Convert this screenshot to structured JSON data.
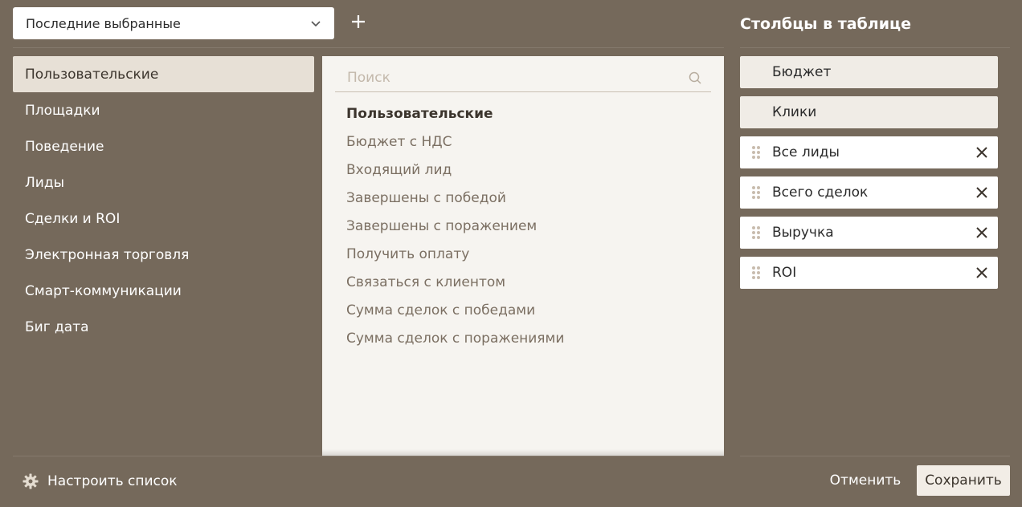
{
  "preset": {
    "value": "Последние выбранные"
  },
  "categories": [
    {
      "label": "Пользовательские",
      "active": true
    },
    {
      "label": "Площадки"
    },
    {
      "label": "Поведение"
    },
    {
      "label": "Лиды"
    },
    {
      "label": "Сделки и ROI"
    },
    {
      "label": "Электронная торговля"
    },
    {
      "label": "Смарт-коммуникации"
    },
    {
      "label": "Биг дата"
    }
  ],
  "search": {
    "placeholder": "Поиск"
  },
  "metrics": {
    "heading": "Пользовательские",
    "items": [
      "Бюджет с НДС",
      "Входящий лид",
      "Завершены с победой",
      "Завершены с поражением",
      "Получить оплату",
      "Связаться с клиентом",
      "Сумма сделок с победами",
      "Сумма сделок с поражениями"
    ]
  },
  "columns": {
    "title": "Столбцы в таблице",
    "items": [
      {
        "label": "Бюджет",
        "locked": true
      },
      {
        "label": "Клики",
        "locked": true
      },
      {
        "label": "Все лиды",
        "locked": false
      },
      {
        "label": "Всего сделок",
        "locked": false
      },
      {
        "label": "Выручка",
        "locked": false
      },
      {
        "label": "ROI",
        "locked": false
      }
    ]
  },
  "footer": {
    "configure_label": "Настроить список",
    "cancel_label": "Отменить",
    "save_label": "Сохранить"
  },
  "colors": {
    "background": "#75695b",
    "panel": "#f6f4f0",
    "active_category": "#e7e0d6",
    "muted_text": "#7b6f62"
  },
  "icons": {
    "dropdown": "chevron-down-icon",
    "add": "plus-icon",
    "search": "search-icon",
    "drag": "drag-handle-icon",
    "remove": "close-icon",
    "configure": "gear-icon"
  }
}
